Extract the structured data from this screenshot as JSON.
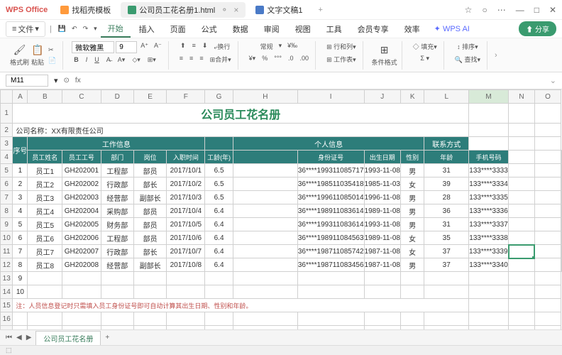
{
  "app": {
    "name": "WPS Office"
  },
  "tabs": [
    {
      "label": "找稻壳模板",
      "icon": "#ff9a3c"
    },
    {
      "label": "公司员工花名册1.html",
      "icon": "#3a9b6f",
      "active": true
    },
    {
      "label": "文字文稿1",
      "icon": "#4a7ac7"
    }
  ],
  "win": {
    "plus": "+",
    "menu": "⋯",
    "min": "—",
    "max": "□",
    "close": "✕",
    "star": "☆",
    "bell": "○"
  },
  "menubar": {
    "file": "文件",
    "tabs": [
      "开始",
      "插入",
      "页面",
      "公式",
      "数据",
      "审阅",
      "视图",
      "工具",
      "会员专享",
      "效率"
    ],
    "active": "开始",
    "ai": "WPS AI",
    "share": "分享",
    "cloud": "⬆"
  },
  "ribbon": {
    "paste": "格式刷",
    "paste2": "粘贴",
    "font": "微软雅黑",
    "size": "9",
    "wrap": "换行",
    "merge": "合并",
    "general": "常规",
    "rowcol": "行和列",
    "worksheet": "工作表",
    "cond": "条件格式",
    "fill": "填充",
    "sort": "排序",
    "find": "查找"
  },
  "cell": {
    "ref": "M11",
    "fx": "fx"
  },
  "cols": [
    "",
    "A",
    "B",
    "C",
    "D",
    "E",
    "F",
    "G",
    "H",
    "I",
    "J",
    "K",
    "L",
    "M",
    "N",
    "O"
  ],
  "title": "公司员工花名册",
  "company": "公司名称：XX有限责任公司",
  "headers1": {
    "seq": "序号",
    "work": "工作信息",
    "personal": "个人信息",
    "contact": "联系方式"
  },
  "headers2": [
    "员工姓名",
    "员工工号",
    "部门",
    "岗位",
    "入职时间",
    "工龄(年)",
    "身份证号",
    "出生日期",
    "性别",
    "年龄",
    "手机号码"
  ],
  "rows": [
    {
      "n": "1",
      "name": "员工1",
      "id": "GH202001",
      "dept": "工程部",
      "pos": "部员",
      "date": "2017/10/1",
      "yrs": "6.5",
      "idc": "36****199311085717",
      "dob": "1993-11-08",
      "sex": "男",
      "age": "31",
      "tel": "133****3333"
    },
    {
      "n": "2",
      "name": "员工2",
      "id": "GH202002",
      "dept": "行政部",
      "pos": "部长",
      "date": "2017/10/2",
      "yrs": "6.5",
      "idc": "36****198511035418",
      "dob": "1985-11-03",
      "sex": "女",
      "age": "39",
      "tel": "133****3334"
    },
    {
      "n": "3",
      "name": "员工3",
      "id": "GH202003",
      "dept": "经营部",
      "pos": "副部长",
      "date": "2017/10/3",
      "yrs": "6.5",
      "idc": "36****199611085014",
      "dob": "1996-11-08",
      "sex": "男",
      "age": "28",
      "tel": "133****3335"
    },
    {
      "n": "4",
      "name": "员工4",
      "id": "GH202004",
      "dept": "采购部",
      "pos": "部员",
      "date": "2017/10/4",
      "yrs": "6.4",
      "idc": "36****198911083614",
      "dob": "1989-11-08",
      "sex": "男",
      "age": "36",
      "tel": "133****3336"
    },
    {
      "n": "5",
      "name": "员工5",
      "id": "GH202005",
      "dept": "财务部",
      "pos": "部员",
      "date": "2017/10/5",
      "yrs": "6.4",
      "idc": "36****199311083614",
      "dob": "1993-11-08",
      "sex": "男",
      "age": "31",
      "tel": "133****3337"
    },
    {
      "n": "6",
      "name": "员工6",
      "id": "GH202006",
      "dept": "工程部",
      "pos": "部员",
      "date": "2017/10/6",
      "yrs": "6.4",
      "idc": "36****198911084563",
      "dob": "1989-11-08",
      "sex": "女",
      "age": "35",
      "tel": "133****3338"
    },
    {
      "n": "7",
      "name": "员工7",
      "id": "GH202007",
      "dept": "行政部",
      "pos": "部长",
      "date": "2017/10/7",
      "yrs": "6.4",
      "idc": "36****198711085742",
      "dob": "1987-11-08",
      "sex": "女",
      "age": "37",
      "tel": "133****3339"
    },
    {
      "n": "8",
      "name": "员工8",
      "id": "GH202008",
      "dept": "经营部",
      "pos": "副部长",
      "date": "2017/10/8",
      "yrs": "6.4",
      "idc": "36****198711083456",
      "dob": "1987-11-08",
      "sex": "男",
      "age": "37",
      "tel": "133****3340"
    }
  ],
  "note": "注：人员信息登记时只需填入员工身份证号即可自动计算其出生日期、性别和年龄。",
  "sheetTab": "公司员工花名册",
  "sheetNav": {
    "first": "⏮",
    "prev": "◀",
    "next": "▶",
    "add": "+"
  }
}
